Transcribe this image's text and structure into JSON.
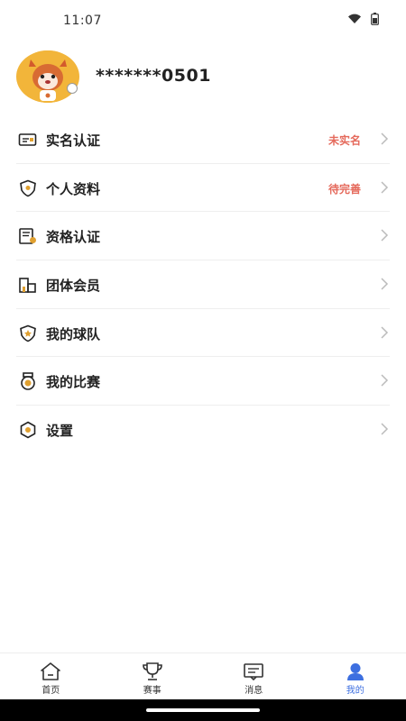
{
  "status_bar": {
    "time": "11:07",
    "icons": [
      "wifi-icon",
      "battery-icon"
    ]
  },
  "profile": {
    "masked_phone": "*******0501",
    "avatar": "mascot-avatar"
  },
  "menu": [
    {
      "key": "real-name",
      "label": "实名认证",
      "status": "未实名",
      "icon": "id-card-icon"
    },
    {
      "key": "profile",
      "label": "个人资料",
      "status": "待完善",
      "icon": "shield-icon"
    },
    {
      "key": "qualification",
      "label": "资格认证",
      "status": "",
      "icon": "certificate-icon"
    },
    {
      "key": "group-member",
      "label": "团体会员",
      "status": "",
      "icon": "building-icon"
    },
    {
      "key": "my-team",
      "label": "我的球队",
      "status": "",
      "icon": "team-shield-icon"
    },
    {
      "key": "my-match",
      "label": "我的比赛",
      "status": "",
      "icon": "medal-icon"
    },
    {
      "key": "settings",
      "label": "设置",
      "status": "",
      "icon": "settings-icon"
    }
  ],
  "tab_bar": {
    "tabs": [
      {
        "label": "首页",
        "icon": "home-icon",
        "active": false
      },
      {
        "label": "赛事",
        "icon": "trophy-icon",
        "active": false
      },
      {
        "label": "消息",
        "icon": "message-icon",
        "active": false
      },
      {
        "label": "我的",
        "icon": "user-icon",
        "active": true
      }
    ]
  },
  "colors": {
    "accent": "#3d6fe0",
    "warning": "#e56a5c",
    "avatar_bg": "#f2b53a"
  }
}
